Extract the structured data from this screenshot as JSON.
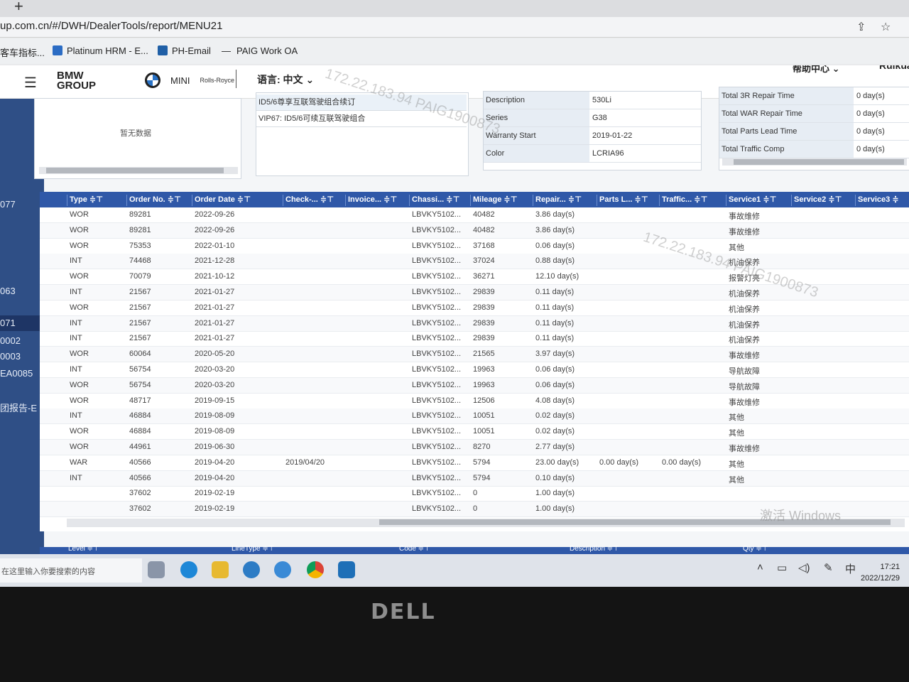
{
  "browser": {
    "new_tab": "+",
    "url": "up.com.cn/#/DWH/DealerTools/report/MENU21",
    "bookmarks": [
      "客车指标...",
      "Platinum HRM - E...",
      "PH-Email",
      "PAIG Work OA"
    ]
  },
  "header": {
    "logo": "BMW\nGROUP",
    "brands": [
      "BMW",
      "MINI",
      "Rolls-Royce"
    ],
    "language": "语言: 中文",
    "help": "帮助中心",
    "user": "Ruikua"
  },
  "sidebar": {
    "items": [
      "077",
      "063",
      "071",
      "0002",
      "0003",
      "EA0085",
      "团报告-E"
    ]
  },
  "left_panel": {
    "empty_text": "暂无数据"
  },
  "packages": [
    "ID5/6尊享互联驾驶组合续订",
    "VIP67: ID5/6可续互联驾驶组合"
  ],
  "vehicle_info": [
    {
      "label": "Description",
      "value": "530Li"
    },
    {
      "label": "Series",
      "value": "G38"
    },
    {
      "label": "Warranty Start",
      "value": "2019-01-22"
    },
    {
      "label": "Color",
      "value": "LCRIA96"
    }
  ],
  "totals": [
    {
      "label": "Total 3R Repair Time",
      "value": "0 day(s)"
    },
    {
      "label": "Total WAR Repair Time",
      "value": "0 day(s)"
    },
    {
      "label": "Total Parts Lead Time",
      "value": "0 day(s)"
    },
    {
      "label": "Total Traffic Comp",
      "value": "0 day(s)"
    }
  ],
  "table": {
    "columns": [
      "Type ≑⊤",
      "Order No. ≑⊤",
      "Order Date ≑⊤",
      "Check-... ≑⊤",
      "Invoice... ≑⊤",
      "Chassi... ≑⊤",
      "Mileage ≑⊤",
      "Repair... ≑⊤",
      "Parts L... ≑⊤",
      "Traffic... ≑⊤",
      "Service1 ≑⊤",
      "Service2 ≑⊤",
      "Service3 ≑"
    ],
    "rows": [
      [
        "WOR",
        "89281",
        "2022-09-26",
        "",
        "",
        "LBVKY5102...",
        "40482",
        "3.86 day(s)",
        "",
        "",
        "事故维修",
        "",
        ""
      ],
      [
        "WOR",
        "89281",
        "2022-09-26",
        "",
        "",
        "LBVKY5102...",
        "40482",
        "3.86 day(s)",
        "",
        "",
        "事故维修",
        "",
        ""
      ],
      [
        "WOR",
        "75353",
        "2022-01-10",
        "",
        "",
        "LBVKY5102...",
        "37168",
        "0.06 day(s)",
        "",
        "",
        "其他",
        "",
        ""
      ],
      [
        "INT",
        "74468",
        "2021-12-28",
        "",
        "",
        "LBVKY5102...",
        "37024",
        "0.88 day(s)",
        "",
        "",
        "机油保养",
        "",
        ""
      ],
      [
        "WOR",
        "70079",
        "2021-10-12",
        "",
        "",
        "LBVKY5102...",
        "36271",
        "12.10 day(s)",
        "",
        "",
        "报警灯亮",
        "",
        ""
      ],
      [
        "INT",
        "21567",
        "2021-01-27",
        "",
        "",
        "LBVKY5102...",
        "29839",
        "0.11 day(s)",
        "",
        "",
        "机油保养",
        "",
        ""
      ],
      [
        "WOR",
        "21567",
        "2021-01-27",
        "",
        "",
        "LBVKY5102...",
        "29839",
        "0.11 day(s)",
        "",
        "",
        "机油保养",
        "",
        ""
      ],
      [
        "INT",
        "21567",
        "2021-01-27",
        "",
        "",
        "LBVKY5102...",
        "29839",
        "0.11 day(s)",
        "",
        "",
        "机油保养",
        "",
        ""
      ],
      [
        "INT",
        "21567",
        "2021-01-27",
        "",
        "",
        "LBVKY5102...",
        "29839",
        "0.11 day(s)",
        "",
        "",
        "机油保养",
        "",
        ""
      ],
      [
        "WOR",
        "60064",
        "2020-05-20",
        "",
        "",
        "LBVKY5102...",
        "21565",
        "3.97 day(s)",
        "",
        "",
        "事故维修",
        "",
        ""
      ],
      [
        "INT",
        "56754",
        "2020-03-20",
        "",
        "",
        "LBVKY5102...",
        "19963",
        "0.06 day(s)",
        "",
        "",
        "导航故障",
        "",
        ""
      ],
      [
        "WOR",
        "56754",
        "2020-03-20",
        "",
        "",
        "LBVKY5102...",
        "19963",
        "0.06 day(s)",
        "",
        "",
        "导航故障",
        "",
        ""
      ],
      [
        "WOR",
        "48717",
        "2019-09-15",
        "",
        "",
        "LBVKY5102...",
        "12506",
        "4.08 day(s)",
        "",
        "",
        "事故维修",
        "",
        ""
      ],
      [
        "INT",
        "46884",
        "2019-08-09",
        "",
        "",
        "LBVKY5102...",
        "10051",
        "0.02 day(s)",
        "",
        "",
        "其他",
        "",
        ""
      ],
      [
        "WOR",
        "46884",
        "2019-08-09",
        "",
        "",
        "LBVKY5102...",
        "10051",
        "0.02 day(s)",
        "",
        "",
        "其他",
        "",
        ""
      ],
      [
        "WOR",
        "44961",
        "2019-06-30",
        "",
        "",
        "LBVKY5102...",
        "8270",
        "2.77 day(s)",
        "",
        "",
        "事故维修",
        "",
        ""
      ],
      [
        "WAR",
        "40566",
        "2019-04-20",
        "2019/04/20",
        "",
        "LBVKY5102...",
        "5794",
        "23.00 day(s)",
        "0.00 day(s)",
        "0.00 day(s)",
        "其他",
        "",
        ""
      ],
      [
        "INT",
        "40566",
        "2019-04-20",
        "",
        "",
        "LBVKY5102...",
        "5794",
        "0.10 day(s)",
        "",
        "",
        "其他",
        "",
        ""
      ],
      [
        "",
        "37602",
        "2019-02-19",
        "",
        "",
        "LBVKY5102...",
        "0",
        "1.00 day(s)",
        "",
        "",
        "",
        "",
        ""
      ],
      [
        "",
        "37602",
        "2019-02-19",
        "",
        "",
        "LBVKY5102...",
        "0",
        "1.00 day(s)",
        "",
        "",
        "",
        "",
        ""
      ]
    ]
  },
  "bottom_grid_headers": [
    "Level ≑⊤",
    "LineType ≑⊤",
    "Code ≑⊤",
    "Description ≑⊤",
    "Qty ≑⊤"
  ],
  "watermark": "172.22.183.94 PAIG1900873",
  "windows_activate": "激活 Windows",
  "taskbar": {
    "search_placeholder": "在这里输入你要搜索的内容",
    "ime": "中",
    "time": "17:21",
    "date": "2022/12/29"
  },
  "monitor_brand": "DELL"
}
